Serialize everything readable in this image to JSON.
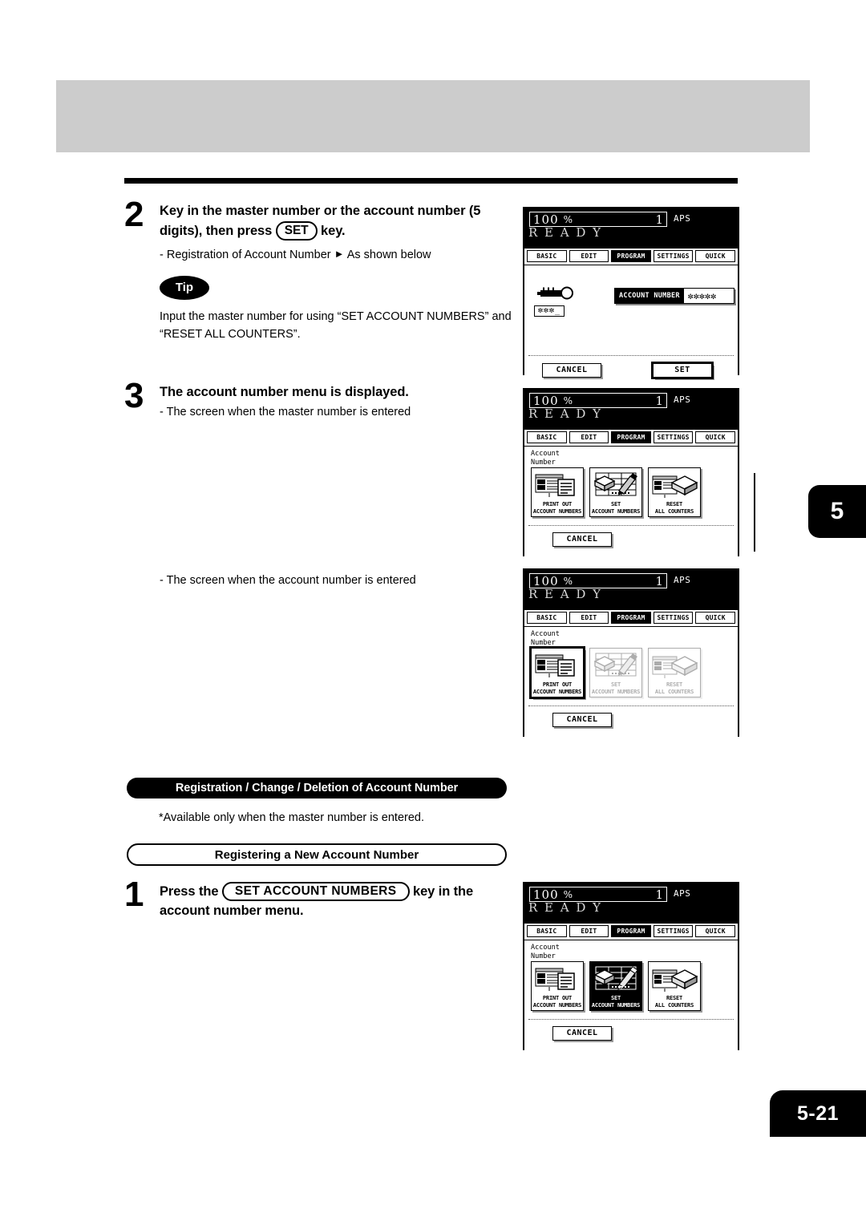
{
  "page": {
    "number": "5-21",
    "chapter": "5"
  },
  "steps": {
    "step2": {
      "num": "2",
      "title_part1": "Key in the master number or the account number (5 digits), then press",
      "key": "SET",
      "title_part2": "key.",
      "sub_prefix": "-",
      "sub_text_a": "Registration of Account Number",
      "sub_arrow": "►",
      "sub_text_b": "As shown below",
      "tip_label": "Tip",
      "tip_text": "Input the master number for using “SET ACCOUNT NUMBERS” and “RESET ALL COUNTERS”."
    },
    "step3": {
      "num": "3",
      "title": "The account number menu is displayed.",
      "sub": "- The screen when the master number is entered",
      "sub2": "- The screen when the account number is entered"
    },
    "step1b": {
      "num": "1",
      "title_part1": "Press the",
      "key": "SET ACCOUNT NUMBERS",
      "title_part2": "key in the account number menu."
    }
  },
  "headings": {
    "black_pill": "Registration / Change / Deletion of Account Number",
    "note": "*Available only when the master number is entered.",
    "outline_pill": "Registering a New Account Number"
  },
  "lcd_common": {
    "ratio_value": "100",
    "percent_symbol": "%",
    "copies": "1",
    "aps": "APS",
    "ready": "R E A D Y",
    "tabs": [
      {
        "label": "BASIC",
        "active": false
      },
      {
        "label": "EDIT",
        "active": false
      },
      {
        "label": "PROGRAM",
        "active": true
      },
      {
        "label": "SETTINGS",
        "active": false
      },
      {
        "label": "QUICK",
        "active": false
      }
    ],
    "cancel": "CANCEL",
    "set": "SET",
    "menu_label_line1": "Account",
    "menu_label_line2": "Number",
    "tiles": [
      {
        "cap1": "PRINT OUT",
        "cap2": "ACCOUNT NUMBERS",
        "icon": "print-account-numbers-icon"
      },
      {
        "cap1": "SET",
        "cap2": "ACCOUNT NUMBERS",
        "icon": "set-account-numbers-icon"
      },
      {
        "cap1": "RESET",
        "cap2": "ALL COUNTERS",
        "icon": "reset-all-counters-icon"
      }
    ]
  },
  "lcd_panel_1": {
    "key_icon": "key-icon",
    "stars_entry": "✼✼✼_",
    "account_label": "ACCOUNT NUMBER",
    "account_value": "✼✼✼✼✼"
  },
  "colors": {
    "header_band": "#cccccc",
    "black": "#000000",
    "white": "#ffffff",
    "lcd_ready_text": "#d8d8d8"
  }
}
